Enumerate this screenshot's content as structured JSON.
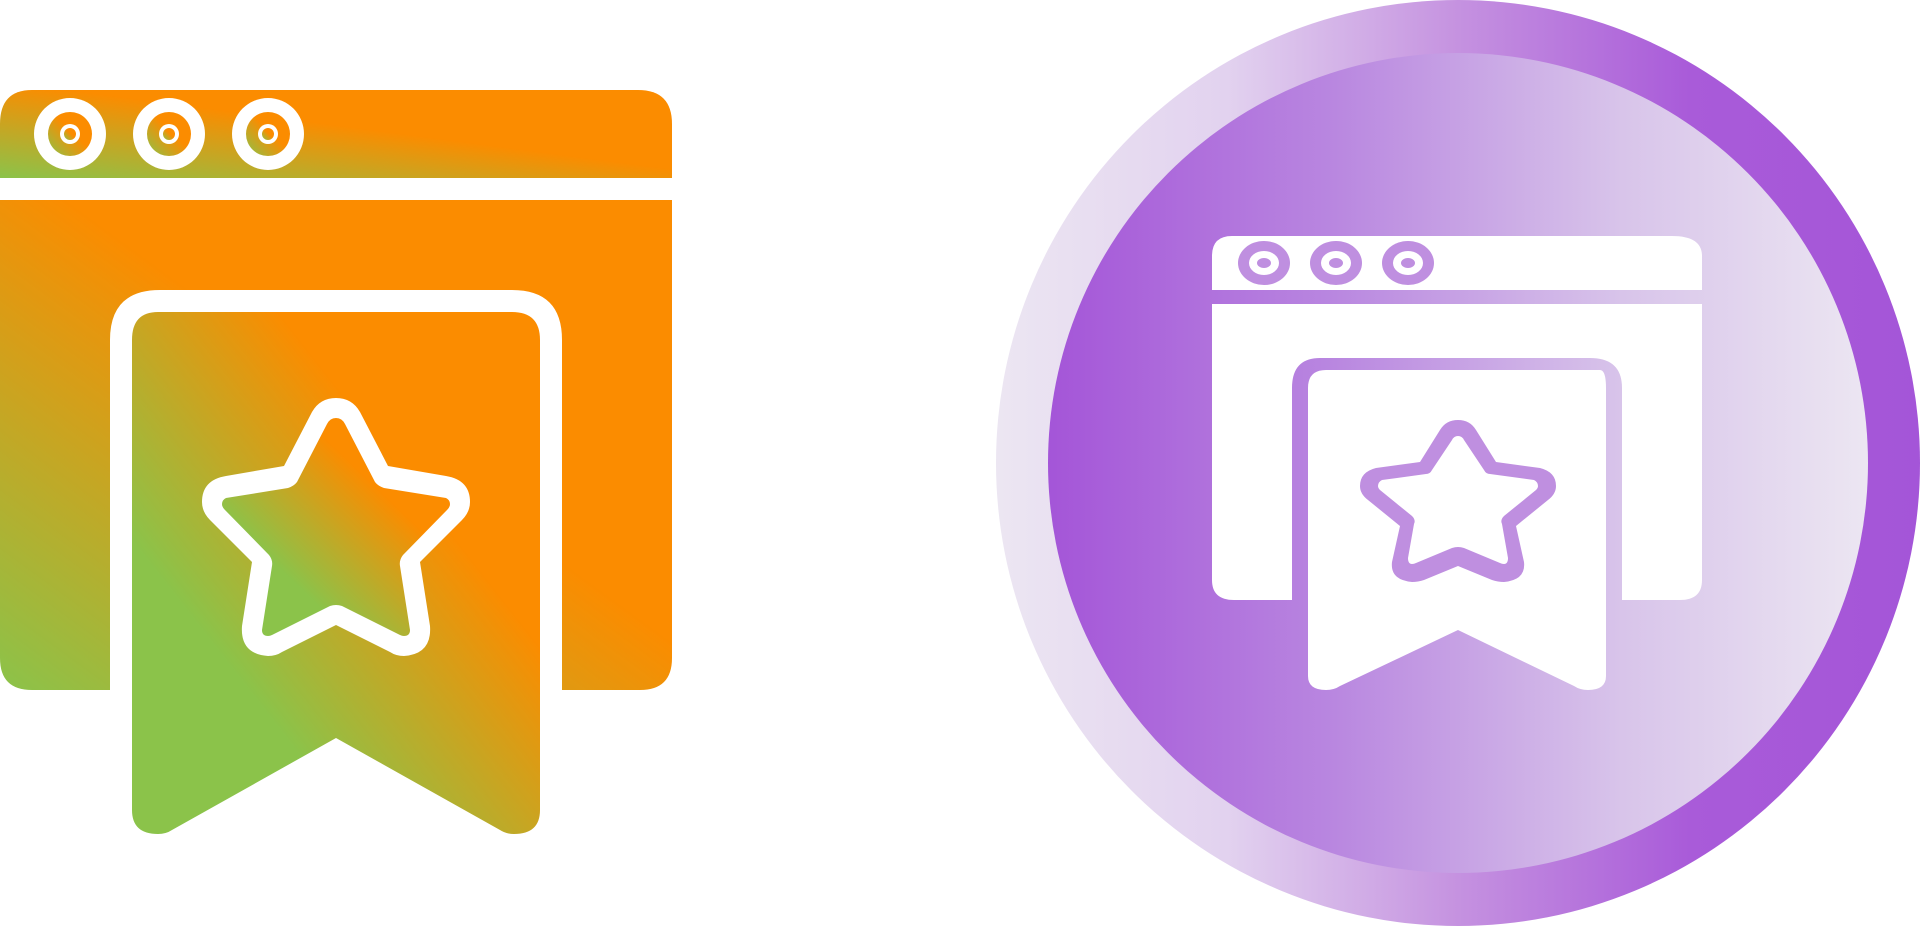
{
  "icons": [
    {
      "name": "bookmark-browser-gradient-icon",
      "style": "gradient-glyph",
      "colors": {
        "gradient_start": "#8bc34a",
        "gradient_end": "#fb8c00",
        "cutout": "#ffffff"
      }
    },
    {
      "name": "bookmark-browser-circle-icon",
      "style": "circle-badge",
      "colors": {
        "circle_light": "#ece6f2",
        "circle_dark": "#a455d8",
        "glyph_fill": "#ffffff",
        "glyph_stroke": "#bf8fe0"
      }
    }
  ]
}
